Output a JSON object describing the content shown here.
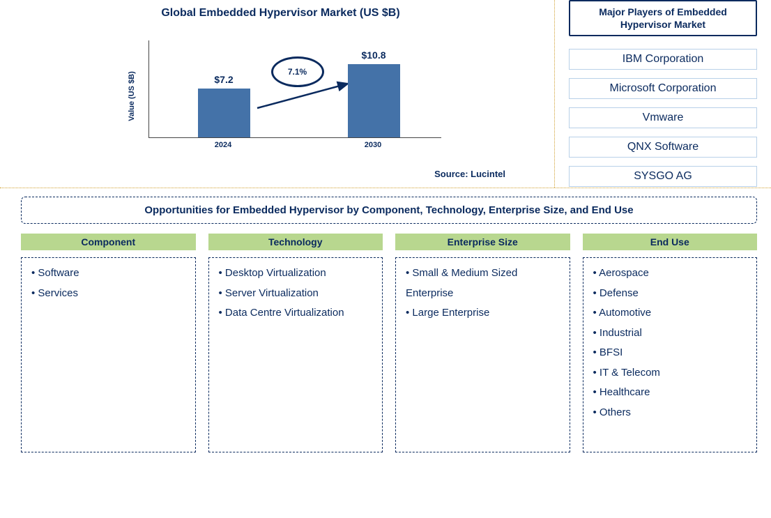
{
  "chart_data": {
    "type": "bar",
    "title": "Global Embedded Hypervisor Market (US $B)",
    "ylabel": "Value (US $B)",
    "categories": [
      "2024",
      "2030"
    ],
    "values": [
      7.2,
      10.8
    ],
    "value_labels": [
      "$7.2",
      "$10.8"
    ],
    "growth_annotation": "7.1%",
    "ylim": [
      0,
      12
    ]
  },
  "source": "Source: Lucintel",
  "players": {
    "title": "Major Players of Embedded Hypervisor Market",
    "list": [
      "IBM Corporation",
      "Microsoft Corporation",
      "Vmware",
      "QNX Software",
      "SYSGO AG"
    ]
  },
  "opportunities": {
    "title": "Opportunities for Embedded Hypervisor by Component, Technology, Enterprise Size, and End Use",
    "columns": [
      {
        "header": "Component",
        "items": [
          "Software",
          "Services"
        ]
      },
      {
        "header": "Technology",
        "items": [
          "Desktop Virtualization",
          "Server Virtualization",
          "Data Centre Virtualization"
        ]
      },
      {
        "header": "Enterprise Size",
        "items": [
          "Small & Medium Sized Enterprise",
          "Large Enterprise"
        ]
      },
      {
        "header": "End Use",
        "items": [
          "Aerospace",
          "Defense",
          "Automotive",
          "Industrial",
          "BFSI",
          "IT & Telecom",
          "Healthcare",
          "Others"
        ]
      }
    ]
  }
}
